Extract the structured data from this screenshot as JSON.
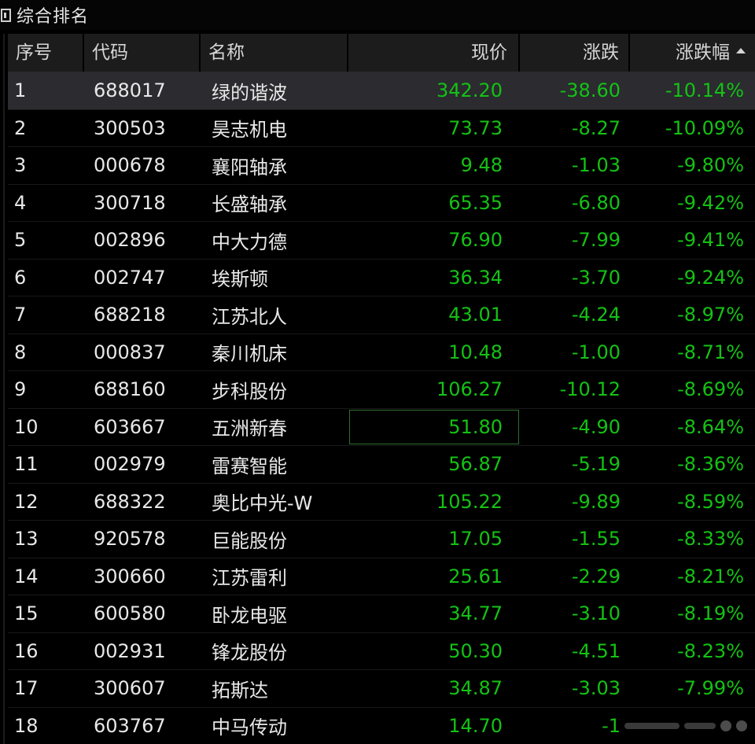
{
  "window": {
    "title": "综合排名"
  },
  "table": {
    "headers": {
      "index": "序号",
      "code": "代码",
      "name": "名称",
      "price": "现价",
      "change": "涨跌",
      "change_pct": "涨跌幅"
    },
    "sort": {
      "column": "change_pct",
      "direction": "ascending"
    },
    "selected_row": 0,
    "focused_row": 9,
    "rows": [
      {
        "index": "1",
        "code": "688017",
        "name": "绿的谐波",
        "price": "342.20",
        "change": "-38.60",
        "change_pct": "-10.14%"
      },
      {
        "index": "2",
        "code": "300503",
        "name": "昊志机电",
        "price": "73.73",
        "change": "-8.27",
        "change_pct": "-10.09%"
      },
      {
        "index": "3",
        "code": "000678",
        "name": "襄阳轴承",
        "price": "9.48",
        "change": "-1.03",
        "change_pct": "-9.80%"
      },
      {
        "index": "4",
        "code": "300718",
        "name": "长盛轴承",
        "price": "65.35",
        "change": "-6.80",
        "change_pct": "-9.42%"
      },
      {
        "index": "5",
        "code": "002896",
        "name": "中大力德",
        "price": "76.90",
        "change": "-7.99",
        "change_pct": "-9.41%"
      },
      {
        "index": "6",
        "code": "002747",
        "name": "埃斯顿",
        "price": "36.34",
        "change": "-3.70",
        "change_pct": "-9.24%"
      },
      {
        "index": "7",
        "code": "688218",
        "name": "江苏北人",
        "price": "43.01",
        "change": "-4.24",
        "change_pct": "-8.97%"
      },
      {
        "index": "8",
        "code": "000837",
        "name": "秦川机床",
        "price": "10.48",
        "change": "-1.00",
        "change_pct": "-8.71%"
      },
      {
        "index": "9",
        "code": "688160",
        "name": "步科股份",
        "price": "106.27",
        "change": "-10.12",
        "change_pct": "-8.69%"
      },
      {
        "index": "10",
        "code": "603667",
        "name": "五洲新春",
        "price": "51.80",
        "change": "-4.90",
        "change_pct": "-8.64%"
      },
      {
        "index": "11",
        "code": "002979",
        "name": "雷赛智能",
        "price": "56.87",
        "change": "-5.19",
        "change_pct": "-8.36%"
      },
      {
        "index": "12",
        "code": "688322",
        "name": "奥比中光-W",
        "price": "105.22",
        "change": "-9.89",
        "change_pct": "-8.59%"
      },
      {
        "index": "13",
        "code": "920578",
        "name": "巨能股份",
        "price": "17.05",
        "change": "-1.55",
        "change_pct": "-8.33%"
      },
      {
        "index": "14",
        "code": "300660",
        "name": "江苏雷利",
        "price": "25.61",
        "change": "-2.29",
        "change_pct": "-8.21%"
      },
      {
        "index": "15",
        "code": "600580",
        "name": "卧龙电驱",
        "price": "34.77",
        "change": "-3.10",
        "change_pct": "-8.19%"
      },
      {
        "index": "16",
        "code": "002931",
        "name": "锋龙股份",
        "price": "50.30",
        "change": "-4.51",
        "change_pct": "-8.23%"
      },
      {
        "index": "17",
        "code": "300607",
        "name": "拓斯达",
        "price": "34.87",
        "change": "-3.03",
        "change_pct": "-7.99%"
      },
      {
        "index": "18",
        "code": "603767",
        "name": "中马传动",
        "price": "14.70",
        "change": "-1",
        "change_pct": ""
      }
    ]
  },
  "colors": {
    "background": "#000000",
    "header_bg": "#1c1c1c",
    "selected_row_bg": "#2b2b30",
    "down_green": "#14c214",
    "text": "#e8e8e8"
  },
  "icons": {
    "title": "panel-toggle-icon",
    "sort": "sort-ascending-icon"
  }
}
